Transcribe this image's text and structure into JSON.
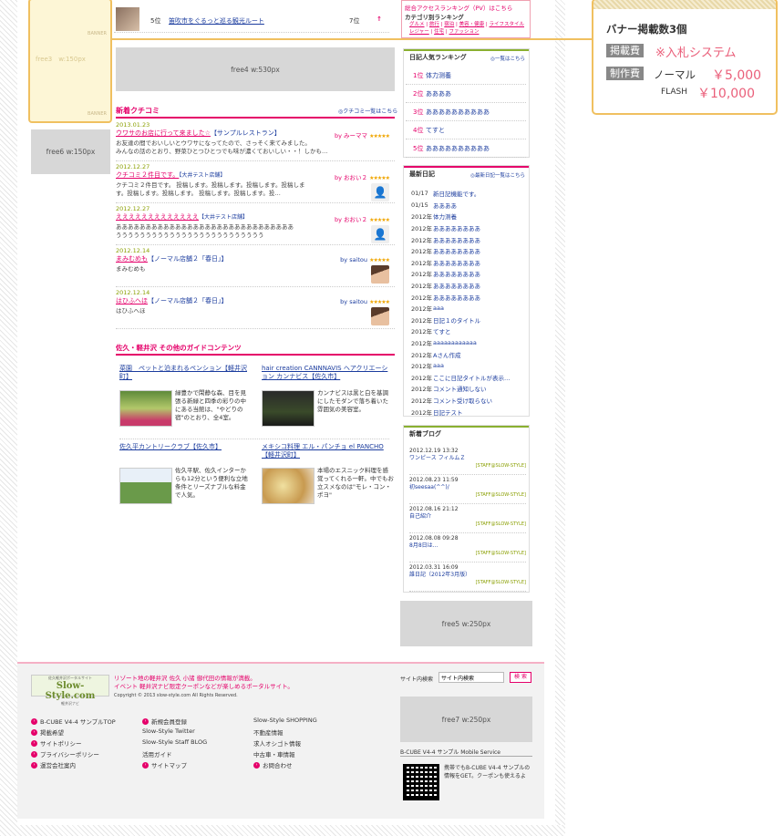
{
  "top_box": {
    "banner_label": "BANNER",
    "free3": "free3　w:150px",
    "banner_label2": "BANNER"
  },
  "top_list": {
    "item_num": "5位",
    "item_text": "笛吹市をぐるっと巡る観光ルート",
    "item_rank": "7位"
  },
  "right_links": {
    "access_ranking": "総合アクセスランキング（PV）はこちら",
    "category_ranking": "カテゴリ別ランキング",
    "categories": [
      "グルメ",
      "旅行",
      "宿泊",
      "美容・健康",
      "ライフスタイル",
      "レジャー",
      "住宅",
      "ファッション"
    ]
  },
  "callout": {
    "title": "バナー掲載数3個",
    "fee_label": "掲載費",
    "fee_value": "※入札システム",
    "prod_label": "制作費",
    "normal_label": "ノーマル",
    "normal_price": "￥5,000",
    "flash_label": "FLASH",
    "flash_price": "￥10,000"
  },
  "free4": "free4 w:530px",
  "free6": "free6 w:150px",
  "free5": "free5 w:250px",
  "free7": "free7 w:250px",
  "reviews": {
    "title": "新着クチコミ",
    "more": "クチコミ一覧はこちら",
    "items": [
      {
        "date": "2013.01.23",
        "title": "ウワサのお店に行って来ました☆",
        "shop": "【サンプルレストラン】",
        "by": "by みーママ",
        "body": "お友達の間でおいしいとウワサになってたので、さっそく来てみました。\nみんなの話のとおり、野菜ひとつひとつでも味が濃くておいしい・・！しかも…"
      },
      {
        "date": "2012.12.27",
        "title": "クチコミ２件目です。",
        "shop": "【大井テスト店舗】",
        "by": "by おおい２",
        "body": "クチコミ２件目です。 投稿します。投稿します。投稿します。投稿しま\nす。投稿します。投稿します。 投稿します。投稿します。投…"
      },
      {
        "date": "2012.12.27",
        "title": "えええええええええええええ",
        "shop": "【大井テスト店舗】",
        "by": "by おおい２",
        "body": "ああああああああああああああああああああああああああああああ\nううううううううううううううううううううううううう"
      },
      {
        "date": "2012.12.14",
        "title": "まみむめも",
        "shop": "【ノーマル店舗２「春日」】",
        "by": "by saitou",
        "body": "まみむめも"
      },
      {
        "date": "2012.12.14",
        "title": "はひふへほ",
        "shop": "【ノーマル店舗２「春日」】",
        "by": "by saitou",
        "body": "はひふへほ"
      }
    ]
  },
  "guide": {
    "title": "佐久・軽井沢 その他のガイドコンテンツ",
    "items": [
      {
        "title": "菜園　ペットと泊まれるペンション【軽井沢町】",
        "desc": "緑豊かで閑静な森、目を見張る新緑と四季の彩りの中にある当館は、\"やどりの宿\"のとおり、全4室。"
      },
      {
        "title": "hair creation CANNNAVIS ヘアクリエーション カンナビス【佐久市】",
        "desc": "カンナビスは黒と白を基調にしたモダンで落ち着いた雰囲気の美容室。"
      },
      {
        "title": "佐久平カントリークラブ【佐久市】",
        "desc": "佐久平駅、佐久インターからも12分という便利な立地条件とリーズナブルな料金で人気。"
      },
      {
        "title": "メキシコ料理 エル・パンチョ el PANCHO【軽井沢町】",
        "desc": "本場のエスニック料理を感覚ってくれる一軒。中でもお立スメなのは\"モレ・コン・ポヨ\""
      }
    ]
  },
  "diary_ranking": {
    "title": "日記人気ランキング",
    "more": "一覧はこちら",
    "items": [
      {
        "rank": "1位",
        "text": "体力测養"
      },
      {
        "rank": "2位",
        "text": "ああああ"
      },
      {
        "rank": "3位",
        "text": "ああああああああああ"
      },
      {
        "rank": "4位",
        "text": "てすと"
      },
      {
        "rank": "5位",
        "text": "ああああああああああ"
      }
    ]
  },
  "latest_diary": {
    "title": "最新日記",
    "more": "最新日記一覧はこちら",
    "items": [
      {
        "date": "01/17",
        "text": "新日記機能です。"
      },
      {
        "date": "01/15",
        "text": "ああああ"
      },
      {
        "date": "2012年",
        "text": "体力测養"
      },
      {
        "date": "2012年",
        "text": "ああああああああ"
      },
      {
        "date": "2012年",
        "text": "ああああああああ"
      },
      {
        "date": "2012年",
        "text": "ああああああああ"
      },
      {
        "date": "2012年",
        "text": "ああああああああ"
      },
      {
        "date": "2012年",
        "text": "ああああああああ"
      },
      {
        "date": "2012年",
        "text": "ああああああああ"
      },
      {
        "date": "2012年",
        "text": "ああああああああ"
      },
      {
        "date": "2012年",
        "text": "aaa"
      },
      {
        "date": "2012年",
        "text": "日記１のタイトル"
      },
      {
        "date": "2012年",
        "text": "てすと"
      },
      {
        "date": "2012年",
        "text": "aaaaaaaaaaaa"
      },
      {
        "date": "2012年",
        "text": "Aさん作成"
      },
      {
        "date": "2012年",
        "text": "aaa"
      },
      {
        "date": "2012年",
        "text": "ここに日記タイトルが表示…"
      },
      {
        "date": "2012年",
        "text": "コメント通知しない"
      },
      {
        "date": "2012年",
        "text": "コメント受け取らない"
      },
      {
        "date": "2012年",
        "text": "日記テスト"
      }
    ]
  },
  "blog": {
    "title": "新着ブログ",
    "items": [
      {
        "date": "2012.12.19 13:32",
        "title": "ワンピース フィルムＺ",
        "staff": "[STAFF@SLOW-STYLE]"
      },
      {
        "date": "2012.08.23 11:59",
        "title": "初seesaa(^^)/",
        "staff": "[STAFF@SLOW-STYLE]"
      },
      {
        "date": "2012.08.16 21:12",
        "title": "自己紹介",
        "staff": "[STAFF@SLOW-STYLE]"
      },
      {
        "date": "2012.08.08 09:28",
        "title": "8月8日は…",
        "staff": "[STAFF@SLOW-STYLE]"
      },
      {
        "date": "2012.03.31 16:09",
        "title": "誰日記（2012年3月版）",
        "staff": "[STAFF@SLOW-STYLE]"
      }
    ]
  },
  "footer": {
    "logo_small": "佐久軽井沢ポータルサイト",
    "logo_text": "Slow-Style.com",
    "logo_sub": "軽井沢ナビ",
    "tagline1": "リゾート地の軽井沢 佐久 小諸 御代田の情報が満載。",
    "tagline2": "イベント 軽井沢ナビ限定クーポンなどが楽しめるポータルサイト。",
    "copyright": "Copyright © 2013 slow-style.com All Rights Reserved.",
    "search_label": "サイト内検索",
    "search_value": "サイト内検索",
    "search_button": "検 索",
    "col1": [
      "B-CUBE V4-4 サンプルTOP",
      "掲載希望",
      "サイトポリシー",
      "プライバシーポリシー",
      "運営会社案内"
    ],
    "col2": [
      "新規会員登録",
      "Slow-Style Twitter",
      "Slow-Style Staff BLOG",
      "活用ガイド",
      "サイトマップ"
    ],
    "col3": [
      "Slow-Style SHOPPING",
      "不動産情報",
      "求人オシゴト情報",
      "中古車・車情報",
      "お問合わせ"
    ],
    "mobile_title": "B-CUBE V4-4 サンプル Mobile Service",
    "mobile_desc": "携帯でもB-CUBE V4-4 サンプルの情報をGET。クーポンも使えるよ"
  }
}
